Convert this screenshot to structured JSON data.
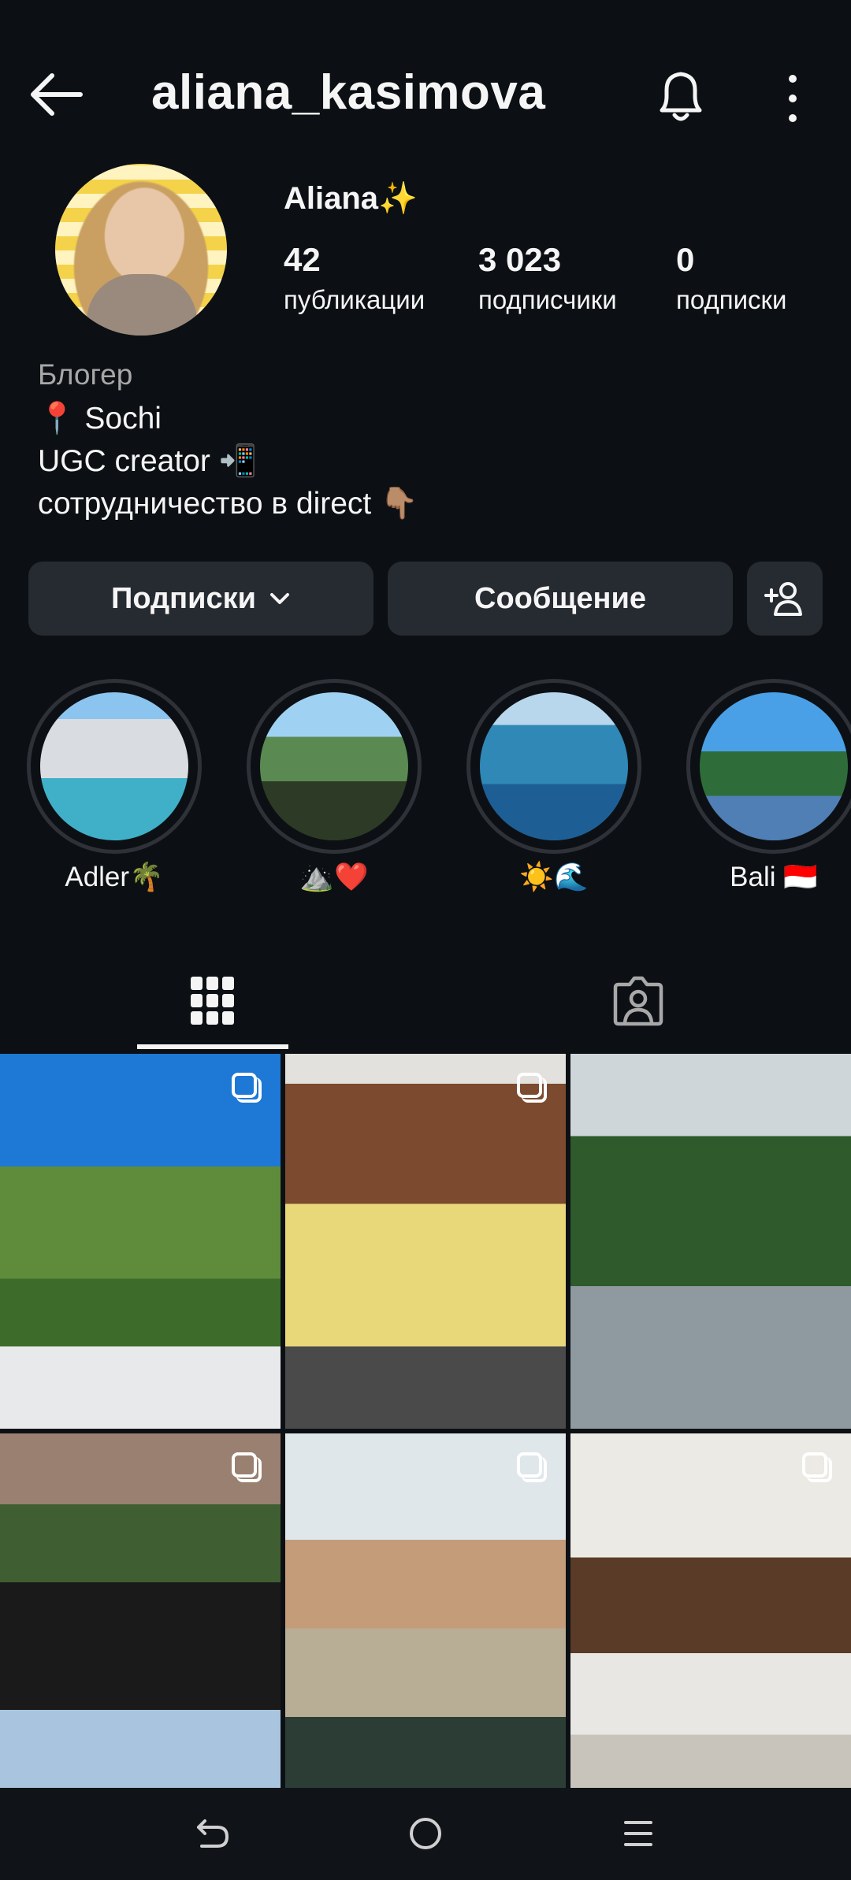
{
  "header": {
    "username": "aliana_kasimova",
    "back_icon": "arrow-left-icon",
    "bell_icon": "bell-icon",
    "more_icon": "more-vertical-icon"
  },
  "profile": {
    "display_name": "Aliana✨",
    "stats": [
      {
        "value": "42",
        "label": "публикации"
      },
      {
        "value": "3 023",
        "label": "подписчики"
      },
      {
        "value": "0",
        "label": "подписки"
      }
    ],
    "category": "Блогер",
    "bio": [
      "📍 Sochi",
      "UGC creator 📲",
      "сотрудничество в direct 👇🏽"
    ]
  },
  "actions": {
    "following_label": "Подписки",
    "message_label": "Сообщение",
    "add_person_icon": "add-person-icon"
  },
  "highlights": [
    {
      "label": "Adler🌴"
    },
    {
      "label": "⛰️❤️"
    },
    {
      "label": "☀️🌊"
    },
    {
      "label": "Bali 🇮🇩"
    }
  ],
  "tabs": [
    {
      "name": "posts-grid",
      "icon": "grid-icon",
      "active": true
    },
    {
      "name": "tagged",
      "icon": "tagged-person-icon",
      "active": false
    }
  ],
  "posts": [
    {
      "multi": true
    },
    {
      "multi": true
    },
    {
      "multi": false
    },
    {
      "multi": true
    },
    {
      "multi": true
    },
    {
      "multi": true
    }
  ],
  "navbar": {
    "back_icon": "nav-back-icon",
    "home_icon": "nav-home-icon",
    "recents_icon": "nav-recents-icon"
  },
  "colors": {
    "background": "#0c1014",
    "button": "#262a31",
    "text": "#f5f5f5",
    "secondary_text": "#a8a8a8"
  }
}
